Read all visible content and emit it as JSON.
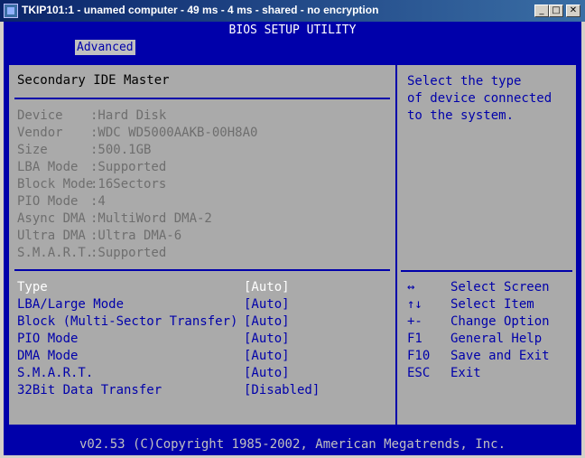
{
  "window": {
    "title": "TKIP101:1 - unamed computer - 49 ms - 4 ms - shared - no encryption",
    "minimize_glyph": "_",
    "restore_glyph": "□",
    "close_glyph": "✕"
  },
  "bios": {
    "title": "BIOS SETUP UTILITY",
    "active_tab": "Advanced",
    "section_title": "Secondary IDE Master",
    "device_info": [
      {
        "label": "Device",
        "value": ":Hard Disk"
      },
      {
        "label": "Vendor",
        "value": ":WDC WD5000AAKB-00H8A0"
      },
      {
        "label": "Size",
        "value": ":500.1GB"
      },
      {
        "label": "LBA Mode",
        "value": ":Supported"
      },
      {
        "label": "Block Mode",
        "value": ":16Sectors"
      },
      {
        "label": "PIO Mode",
        "value": ":4"
      },
      {
        "label": "Async DMA",
        "value": ":MultiWord DMA-2"
      },
      {
        "label": "Ultra DMA",
        "value": ":Ultra DMA-6"
      },
      {
        "label": "S.M.A.R.T.",
        "value": ":Supported"
      }
    ],
    "settings": [
      {
        "label": "Type",
        "value": "[Auto]"
      },
      {
        "label": "LBA/Large Mode",
        "value": "[Auto]"
      },
      {
        "label": "Block (Multi-Sector Transfer)",
        "value": "[Auto]"
      },
      {
        "label": "PIO Mode",
        "value": "[Auto]"
      },
      {
        "label": "DMA Mode",
        "value": "[Auto]"
      },
      {
        "label": "S.M.A.R.T.",
        "value": "[Auto]"
      },
      {
        "label": "32Bit Data Transfer",
        "value": "[Disabled]"
      }
    ],
    "help_text": [
      "Select the type",
      "of device connected",
      "to the system."
    ],
    "key_help": [
      {
        "key": "↔",
        "action": "Select Screen"
      },
      {
        "key": "↑↓",
        "action": "Select Item"
      },
      {
        "key": "+-",
        "action": "Change Option"
      },
      {
        "key": "F1",
        "action": "General Help"
      },
      {
        "key": "F10",
        "action": "Save and Exit"
      },
      {
        "key": "ESC",
        "action": "Exit"
      }
    ],
    "footer": "v02.53 (C)Copyright 1985-2002, American Megatrends, Inc."
  },
  "colors": {
    "bios_blue": "#0000aa",
    "panel_gray": "#aaaaaa",
    "selected_white": "#ffffff"
  }
}
